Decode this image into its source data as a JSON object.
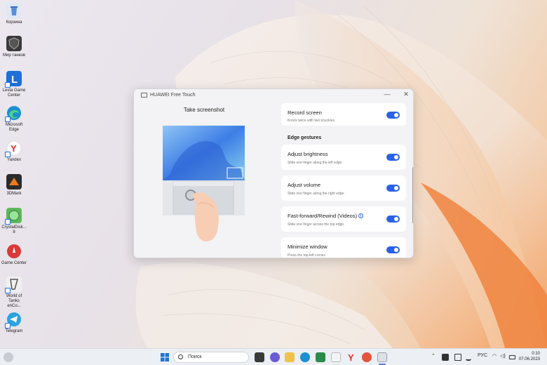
{
  "desktop": {
    "icons": [
      {
        "label": "Корзина",
        "color": "#dfe8f5"
      },
      {
        "label": "Мир танков",
        "color": "#3a3a3a"
      },
      {
        "label": "Lesta Game Center",
        "color": "#1e6fd9"
      },
      {
        "label": "Microsoft Edge",
        "color": "#1b8fd0"
      },
      {
        "label": "Yandex",
        "color": "#ffffff"
      },
      {
        "label": "3DMark",
        "color": "#2b2b2b"
      },
      {
        "label": "CrystalDisk... 8",
        "color": "#5cb85c"
      },
      {
        "label": "Game Center",
        "color": "#d83a3a"
      },
      {
        "label": "World of Tanks enCo...",
        "color": "#f0f0f0"
      },
      {
        "label": "Telegram",
        "color": "#2aa3df"
      }
    ]
  },
  "window": {
    "title": "HUAWEI Free Touch",
    "controls": {
      "minimize": "—",
      "close": "✕"
    },
    "preview_title": "Take screenshot",
    "record": {
      "title": "Record screen",
      "subtitle": "Knock twice with two knuckles.",
      "enabled": true
    },
    "section_edge": "Edge gestures",
    "gestures": [
      {
        "title": "Adjust brightness",
        "subtitle": "Slide one finger along the left edge.",
        "enabled": true
      },
      {
        "title": "Adjust volume",
        "subtitle": "Slide one finger along the right edge.",
        "enabled": true
      },
      {
        "title": "Fast-forward/Rewind (Videos)",
        "subtitle": "Slide one finger across the top edge.",
        "enabled": true,
        "info": "i"
      },
      {
        "title": "Minimize window",
        "subtitle": "Press the top-left corner.",
        "enabled": true
      }
    ]
  },
  "taskbar": {
    "search_placeholder": "Поиск",
    "lang": "РУС",
    "time": "0:10",
    "date": "07.06.2023"
  }
}
